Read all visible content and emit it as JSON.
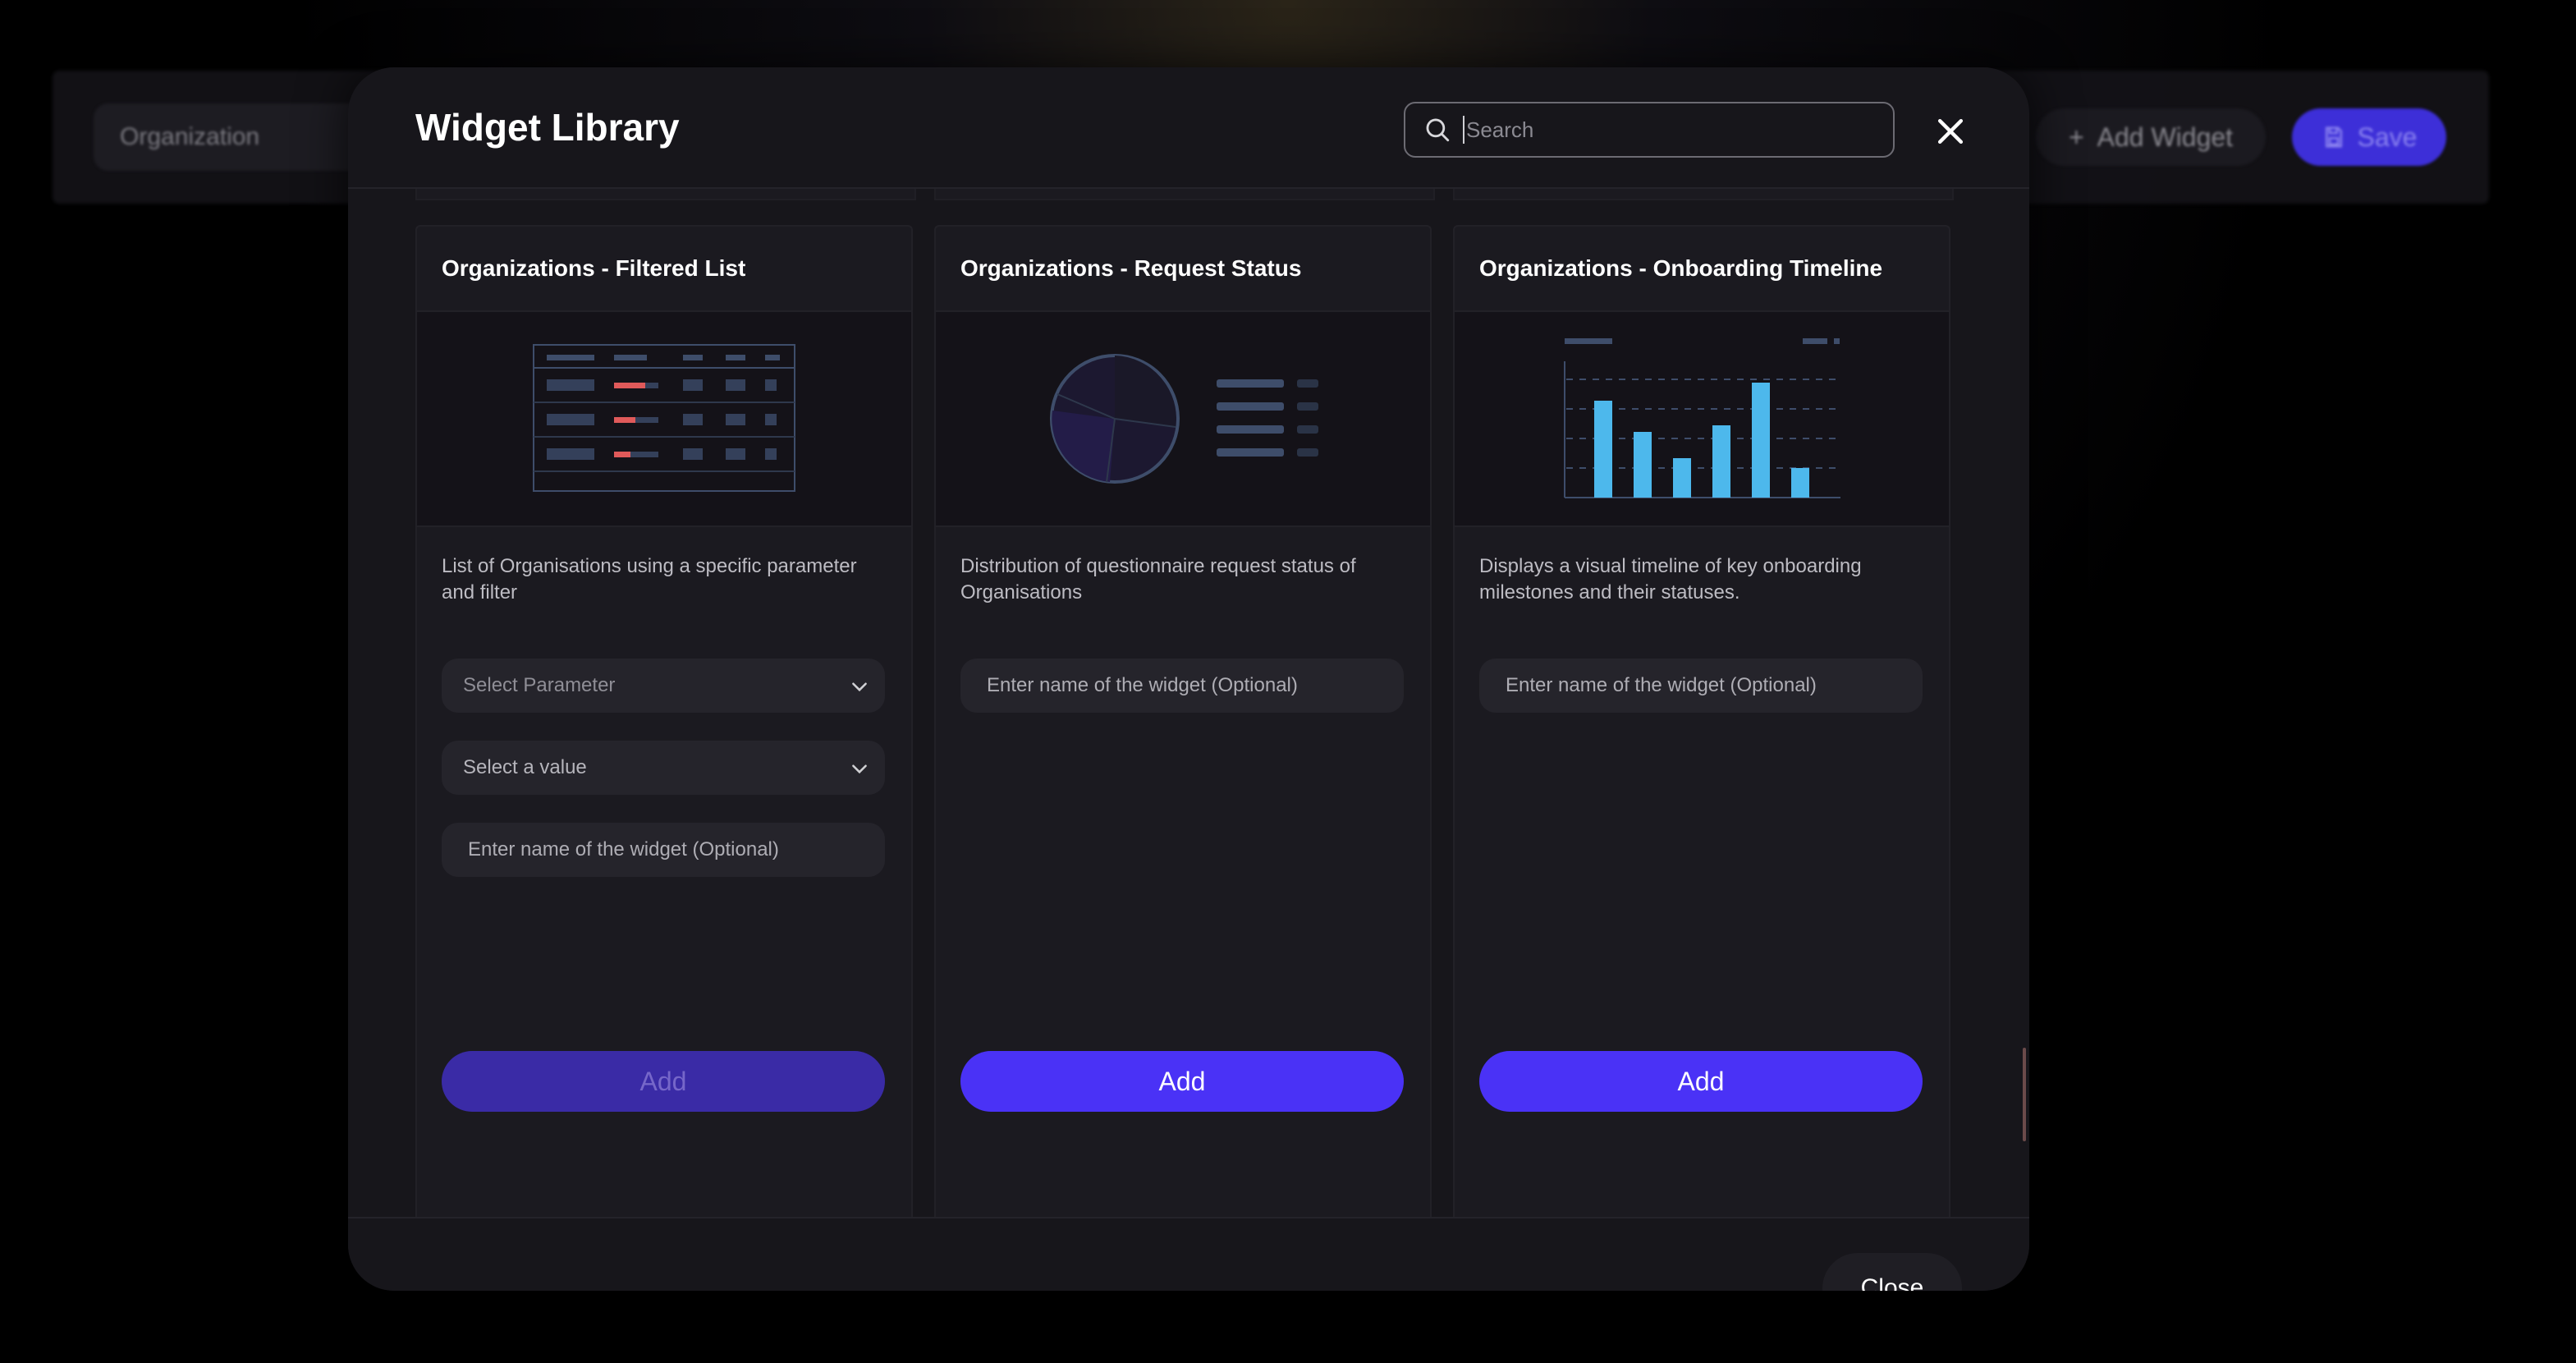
{
  "background": {
    "org_select": "Organization",
    "add_widget_label": "Add Widget",
    "save_label": "Save"
  },
  "modal": {
    "title": "Widget Library",
    "search": {
      "placeholder": "Search",
      "value": ""
    },
    "close_footer_label": "Close"
  },
  "cards": [
    {
      "title": "Organizations - Filtered List",
      "preview": "table-icon",
      "description": "List of Organisations using a specific parameter and filter",
      "parameter_select": "Select Parameter",
      "value_select": "Select a value",
      "name_placeholder": "Enter name of the widget (Optional)",
      "add_label": "Add",
      "add_enabled": false
    },
    {
      "title": "Organizations - Request Status",
      "preview": "pie-chart-icon",
      "description": "Distribution of questionnaire request status of Organisations",
      "name_placeholder": "Enter name of the widget (Optional)",
      "add_label": "Add",
      "add_enabled": true
    },
    {
      "title": "Organizations - Onboarding Timeline",
      "preview": "bar-chart-icon",
      "description": "Displays a visual timeline of key onboarding milestones and their statuses.",
      "name_placeholder": "Enter name of the widget (Optional)",
      "add_label": "Add",
      "add_enabled": true
    }
  ],
  "colors": {
    "accent": "#4a32f6",
    "accent_disabled": "#3a2ba6",
    "modal_bg": "#17161b",
    "card_bg": "#1b1a20",
    "bar_blue": "#4db8ec",
    "warning_red": "#e05a5a"
  }
}
